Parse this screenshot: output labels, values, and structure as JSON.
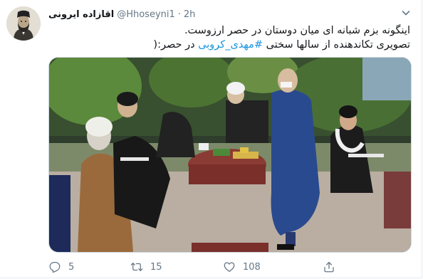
{
  "tweet": {
    "display_name": "اقازاده ایرونی",
    "handle": "@Hhoseyni1",
    "separator": "·",
    "time": "2h",
    "text_line1": "اینگونه بزم شبانه ای میان دوستان در حصر ارزوست.",
    "text_line2_before": "تصویری تکاندهنده از سالها سختی ",
    "hashtag": "#مهدی_کروبی",
    "text_line2_after": " در حصر:(",
    "replies": "5",
    "retweets": "15",
    "likes": "108"
  },
  "icons": {
    "caret": "chevron-down-icon",
    "reply": "reply-icon",
    "retweet": "retweet-icon",
    "like": "heart-icon",
    "share": "share-icon"
  },
  "colors": {
    "link": "#1b95e0",
    "secondary_text": "#657786",
    "primary_text": "#14171a"
  }
}
